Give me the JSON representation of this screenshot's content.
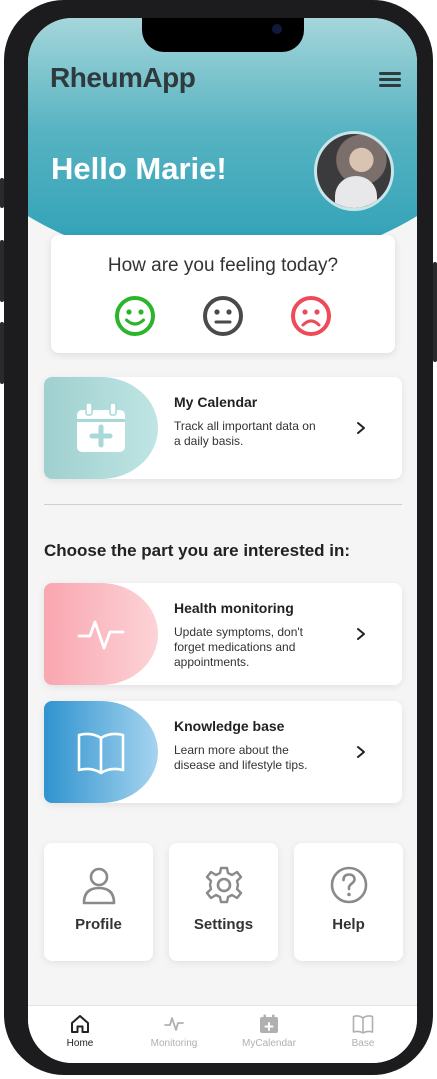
{
  "app": {
    "name": "RheumApp"
  },
  "header": {
    "greeting": "Hello Marie!"
  },
  "mood": {
    "question": "How are you feeling today?",
    "options": [
      "happy",
      "neutral",
      "sad"
    ],
    "colors": {
      "happy": "#2cb52c",
      "neutral": "#4a4a4a",
      "sad": "#ee4b58"
    }
  },
  "calendar_card": {
    "title": "My Calendar",
    "description": "Track all important data on a daily basis.",
    "icon": "calendar-plus-icon"
  },
  "section": {
    "title": "Choose the part you are interested in:"
  },
  "cards": [
    {
      "title": "Health monitoring",
      "description": "Update symptoms, don't forget medications and appointments.",
      "icon": "pulse-icon"
    },
    {
      "title": "Knowledge base",
      "description": "Learn more about the disease and lifestyle tips.",
      "icon": "book-icon"
    }
  ],
  "tiles": [
    {
      "label": "Profile",
      "icon": "user-icon"
    },
    {
      "label": "Settings",
      "icon": "gear-icon"
    },
    {
      "label": "Help",
      "icon": "question-icon"
    }
  ],
  "nav": {
    "items": [
      {
        "label": "Home",
        "icon": "home-icon",
        "active": true
      },
      {
        "label": "Monitoring",
        "icon": "pulse-icon",
        "active": false
      },
      {
        "label": "MyCalendar",
        "icon": "calendar-plus-icon",
        "active": false
      },
      {
        "label": "Base",
        "icon": "book-icon",
        "active": false
      }
    ],
    "active_color": "#222222",
    "inactive_color": "#b0b0b0"
  },
  "colors": {
    "accent": "#2a9fb5",
    "text": "#222222"
  }
}
